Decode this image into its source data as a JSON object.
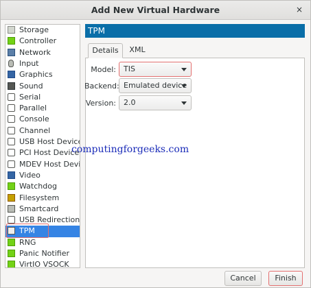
{
  "window": {
    "title": "Add New Virtual Hardware",
    "close_glyph": "×"
  },
  "hardware_list": {
    "items": [
      {
        "label": "Storage",
        "icon": "disk-icon",
        "selected": false
      },
      {
        "label": "Controller",
        "icon": "chip-icon",
        "selected": false
      },
      {
        "label": "Network",
        "icon": "network-icon",
        "selected": false
      },
      {
        "label": "Input",
        "icon": "mouse-icon",
        "selected": false
      },
      {
        "label": "Graphics",
        "icon": "monitor-icon",
        "selected": false
      },
      {
        "label": "Sound",
        "icon": "sound-icon",
        "selected": false
      },
      {
        "label": "Serial",
        "icon": "plug-icon",
        "selected": false
      },
      {
        "label": "Parallel",
        "icon": "plug-icon",
        "selected": false
      },
      {
        "label": "Console",
        "icon": "plug-icon",
        "selected": false
      },
      {
        "label": "Channel",
        "icon": "plug-icon",
        "selected": false
      },
      {
        "label": "USB Host Device",
        "icon": "plug-icon",
        "selected": false
      },
      {
        "label": "PCI Host Device",
        "icon": "plug-icon",
        "selected": false
      },
      {
        "label": "MDEV Host Device",
        "icon": "plug-icon",
        "selected": false
      },
      {
        "label": "Video",
        "icon": "monitor-icon",
        "selected": false
      },
      {
        "label": "Watchdog",
        "icon": "chip-icon",
        "selected": false
      },
      {
        "label": "Filesystem",
        "icon": "folder-icon",
        "selected": false
      },
      {
        "label": "Smartcard",
        "icon": "card-icon",
        "selected": false
      },
      {
        "label": "USB Redirection",
        "icon": "plug-icon",
        "selected": false
      },
      {
        "label": "TPM",
        "icon": "tpm-icon",
        "selected": true
      },
      {
        "label": "RNG",
        "icon": "chip-icon",
        "selected": false
      },
      {
        "label": "Panic Notifier",
        "icon": "chip-icon",
        "selected": false
      },
      {
        "label": "VirtIO VSOCK",
        "icon": "chip-icon",
        "selected": false
      }
    ]
  },
  "detail": {
    "header": "TPM",
    "tabs": [
      {
        "label": "Details",
        "active": true
      },
      {
        "label": "XML",
        "active": false
      }
    ],
    "model": {
      "label": "Model:",
      "value": "TIS"
    },
    "backend": {
      "label": "Backend:",
      "value": "Emulated device"
    },
    "version": {
      "label": "Version:",
      "value": "2.0"
    }
  },
  "watermark": "computingforgeeks.com",
  "buttons": {
    "cancel": "Cancel",
    "finish": "Finish"
  },
  "colors": {
    "accent": "#3584e4",
    "header_bar": "#0a6ea8",
    "annotation_red": "#e46f6f",
    "watermark": "#1a2bb8"
  }
}
